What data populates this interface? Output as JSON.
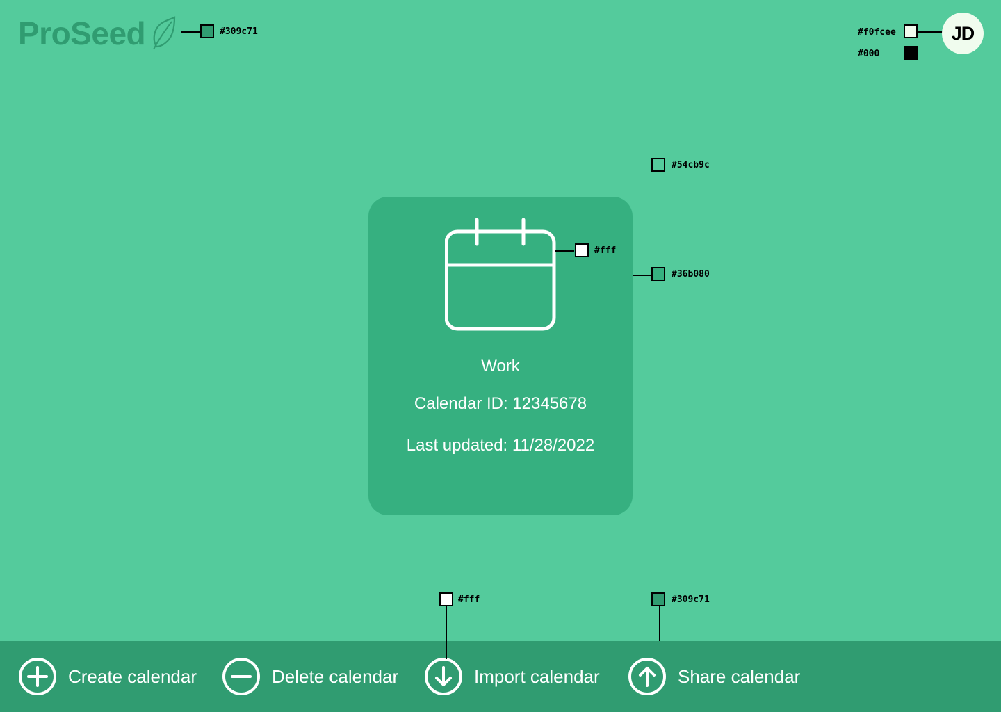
{
  "logo": {
    "text": "ProSeed",
    "color": "#309c71"
  },
  "user": {
    "initials": "JD",
    "bg": "#f0fcee",
    "fg": "#000"
  },
  "card": {
    "name": "Work",
    "calendar_id": "Calendar ID: 12345678",
    "last_updated": "Last updated: 11/28/2022",
    "icon": "calendar-icon"
  },
  "actions": [
    {
      "label": "Create calendar",
      "icon": "plus-circle-icon"
    },
    {
      "label": "Delete calendar",
      "icon": "minus-circle-icon"
    },
    {
      "label": "Import calendar",
      "icon": "arrow-down-circle-icon"
    },
    {
      "label": "Share calendar",
      "icon": "arrow-up-circle-icon"
    }
  ],
  "annotations": {
    "logo_color": "#309c71",
    "avatar_bg": "#f0fcee",
    "avatar_fg": "#000",
    "page_bg": "#54cb9c",
    "icon_color": "#fff",
    "card_bg": "#36b080",
    "action_icon": "#fff",
    "bar_bg": "#309c71"
  }
}
